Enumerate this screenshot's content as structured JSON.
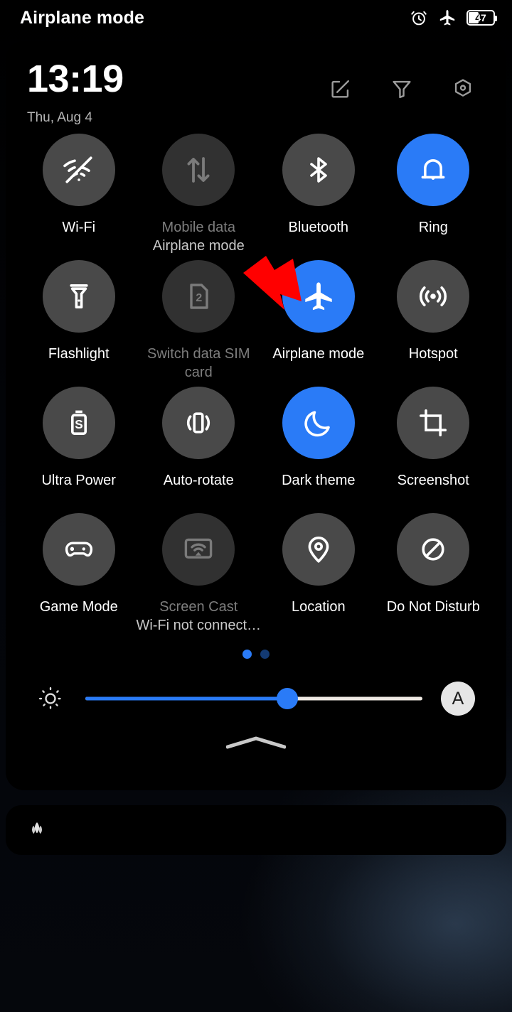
{
  "statusbar": {
    "title": "Airplane mode",
    "icons": [
      "alarm-icon",
      "airplane-icon"
    ],
    "battery_level": "47"
  },
  "qs_header": {
    "clock": "13:19",
    "date": "Thu, Aug 4",
    "icons": [
      {
        "name": "edit-icon",
        "label": "Edit"
      },
      {
        "name": "filter-icon",
        "label": "Filter"
      },
      {
        "name": "settings-icon",
        "label": "Settings"
      }
    ]
  },
  "tiles": [
    {
      "label": "Wi-Fi",
      "sub": "",
      "icon": "wifi-off-icon",
      "state": "off"
    },
    {
      "label": "Mobile data",
      "sub": "Airplane mode",
      "icon": "mobile-data-icon",
      "state": "disabled"
    },
    {
      "label": "Bluetooth",
      "sub": "",
      "icon": "bluetooth-icon",
      "state": "off"
    },
    {
      "label": "Ring",
      "sub": "",
      "icon": "bell-icon",
      "state": "on"
    },
    {
      "label": "Flashlight",
      "sub": "",
      "icon": "flashlight-icon",
      "state": "off"
    },
    {
      "label": "Switch data SIM card",
      "sub": "",
      "icon": "sim-card-2-icon",
      "state": "disabled"
    },
    {
      "label": "Airplane mode",
      "sub": "",
      "icon": "airplane-icon",
      "state": "on"
    },
    {
      "label": "Hotspot",
      "sub": "",
      "icon": "hotspot-icon",
      "state": "off"
    },
    {
      "label": "Ultra Power",
      "sub": "",
      "icon": "battery-saver-icon",
      "state": "off"
    },
    {
      "label": "Auto-rotate",
      "sub": "",
      "icon": "auto-rotate-icon",
      "state": "off"
    },
    {
      "label": "Dark theme",
      "sub": "",
      "icon": "moon-icon",
      "state": "on"
    },
    {
      "label": "Screenshot",
      "sub": "",
      "icon": "crop-icon",
      "state": "off"
    },
    {
      "label": "Game Mode",
      "sub": "",
      "icon": "gamepad-icon",
      "state": "off"
    },
    {
      "label": "Screen Cast",
      "sub": "Wi-Fi not connect…",
      "icon": "screen-cast-icon",
      "state": "disabled"
    },
    {
      "label": "Location",
      "sub": "",
      "icon": "location-pin-icon",
      "state": "off"
    },
    {
      "label": "Do Not Disturb",
      "sub": "",
      "icon": "do-not-disturb-icon",
      "state": "off"
    }
  ],
  "pager": {
    "total_pages": 2,
    "current_page": 1
  },
  "brightness": {
    "value_percent": 60,
    "left_icon": "brightness-sun-icon",
    "auto_label": "A"
  },
  "collapse_handle": {
    "icon": "chevron-up-handle-icon"
  },
  "notification": {
    "app_icon": "lotus-icon"
  },
  "annotation": {
    "arrow": "red-arrow-pointing-airplane-mode"
  },
  "colors": {
    "accent_blue": "#2a7bf7",
    "tile_off": "#494949",
    "tile_disabled": "#313131",
    "panel_bg": "#000000",
    "label": "#ffffff",
    "label_disabled": "#7d7d7d",
    "annotation_red": "#ff0000"
  }
}
